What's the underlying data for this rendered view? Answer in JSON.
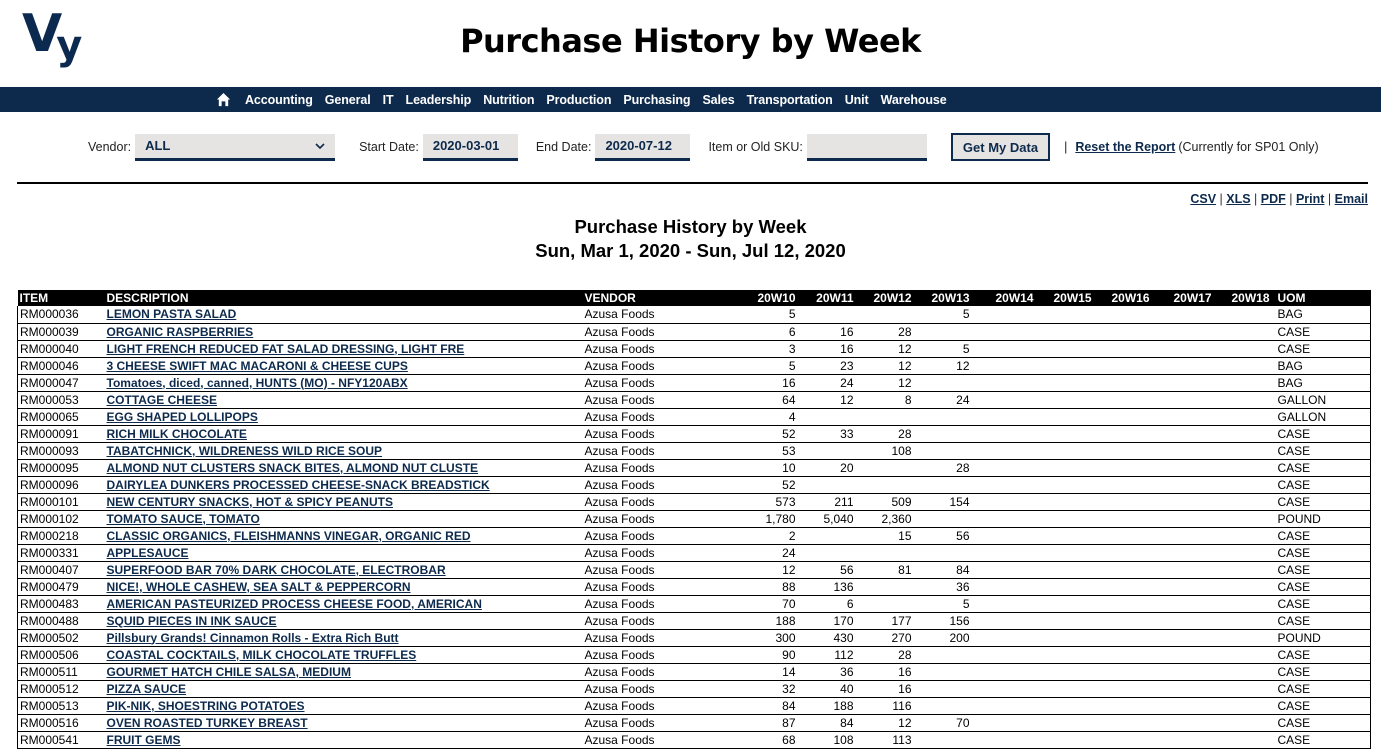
{
  "header": {
    "logo": {
      "v": "V",
      "y": "y"
    },
    "title": "Purchase History by Week"
  },
  "nav": {
    "home_icon": "home-icon",
    "items": [
      "Accounting",
      "General",
      "IT",
      "Leadership",
      "Nutrition",
      "Production",
      "Purchasing",
      "Sales",
      "Transportation",
      "Unit",
      "Warehouse"
    ]
  },
  "filters": {
    "vendor_label": "Vendor:",
    "vendor_value": "ALL",
    "start_label": "Start Date:",
    "start_value": "2020-03-01",
    "end_label": "End Date:",
    "end_value": "2020-07-12",
    "sku_label": "Item or Old SKU:",
    "sku_value": "",
    "get_data_label": "Get My Data",
    "separator": "|",
    "reset_label": "Reset the Report",
    "reset_note": "(Currently for SP01 Only)"
  },
  "exports": {
    "links": [
      "CSV",
      "XLS",
      "PDF",
      "Print",
      "Email"
    ],
    "separator": " | "
  },
  "report": {
    "title": "Purchase History by Week",
    "date_range": "Sun, Mar 1, 2020 - Sun, Jul 12, 2020"
  },
  "table": {
    "columns": [
      "ITEM",
      "DESCRIPTION",
      "VENDOR",
      "20W10",
      "20W11",
      "20W12",
      "20W13",
      "20W14",
      "20W15",
      "20W16",
      "20W17",
      "20W18",
      "UOM"
    ],
    "rows": [
      {
        "item": "RM000036",
        "description": "LEMON PASTA SALAD",
        "vendor": "Azusa Foods",
        "weeks": [
          "5",
          "",
          "",
          "5",
          "",
          "",
          "",
          "",
          ""
        ],
        "uom": "BAG"
      },
      {
        "item": "RM000039",
        "description": "ORGANIC RASPBERRIES",
        "vendor": "Azusa Foods",
        "weeks": [
          "6",
          "16",
          "28",
          "",
          "",
          "",
          "",
          "",
          ""
        ],
        "uom": "CASE"
      },
      {
        "item": "RM000040",
        "description": "LIGHT FRENCH REDUCED FAT SALAD DRESSING, LIGHT FRE",
        "vendor": "Azusa Foods",
        "weeks": [
          "3",
          "16",
          "12",
          "5",
          "",
          "",
          "",
          "",
          ""
        ],
        "uom": "CASE"
      },
      {
        "item": "RM000046",
        "description": "3 CHEESE SWIFT MAC MACARONI & CHEESE CUPS",
        "vendor": "Azusa Foods",
        "weeks": [
          "5",
          "23",
          "12",
          "12",
          "",
          "",
          "",
          "",
          ""
        ],
        "uom": "BAG"
      },
      {
        "item": "RM000047",
        "description": "Tomatoes, diced, canned, HUNTS (MO) - NFY120ABX",
        "vendor": "Azusa Foods",
        "weeks": [
          "16",
          "24",
          "12",
          "",
          "",
          "",
          "",
          "",
          ""
        ],
        "uom": "BAG"
      },
      {
        "item": "RM000053",
        "description": "COTTAGE CHEESE",
        "vendor": "Azusa Foods",
        "weeks": [
          "64",
          "12",
          "8",
          "24",
          "",
          "",
          "",
          "",
          ""
        ],
        "uom": "GALLON"
      },
      {
        "item": "RM000065",
        "description": "EGG SHAPED LOLLIPOPS",
        "vendor": "Azusa Foods",
        "weeks": [
          "4",
          "",
          "",
          "",
          "",
          "",
          "",
          "",
          ""
        ],
        "uom": "GALLON"
      },
      {
        "item": "RM000091",
        "description": "RICH MILK CHOCOLATE",
        "vendor": "Azusa Foods",
        "weeks": [
          "52",
          "33",
          "28",
          "",
          "",
          "",
          "",
          "",
          ""
        ],
        "uom": "CASE"
      },
      {
        "item": "RM000093",
        "description": "TABATCHNICK, WILDRENESS WILD RICE SOUP",
        "vendor": "Azusa Foods",
        "weeks": [
          "53",
          "",
          "108",
          "",
          "",
          "",
          "",
          "",
          ""
        ],
        "uom": "CASE"
      },
      {
        "item": "RM000095",
        "description": "ALMOND NUT CLUSTERS SNACK BITES, ALMOND NUT CLUSTE",
        "vendor": "Azusa Foods",
        "weeks": [
          "10",
          "20",
          "",
          "28",
          "",
          "",
          "",
          "",
          ""
        ],
        "uom": "CASE"
      },
      {
        "item": "RM000096",
        "description": "DAIRYLEA DUNKERS PROCESSED CHEESE-SNACK BREADSTICK",
        "vendor": "Azusa Foods",
        "weeks": [
          "52",
          "",
          "",
          "",
          "",
          "",
          "",
          "",
          ""
        ],
        "uom": "CASE"
      },
      {
        "item": "RM000101",
        "description": "NEW CENTURY SNACKS, HOT & SPICY PEANUTS",
        "vendor": "Azusa Foods",
        "weeks": [
          "573",
          "211",
          "509",
          "154",
          "",
          "",
          "",
          "",
          ""
        ],
        "uom": "CASE"
      },
      {
        "item": "RM000102",
        "description": "TOMATO SAUCE, TOMATO",
        "vendor": "Azusa Foods",
        "weeks": [
          "1,780",
          "5,040",
          "2,360",
          "",
          "",
          "",
          "",
          "",
          ""
        ],
        "uom": "POUND"
      },
      {
        "item": "RM000218",
        "description": "CLASSIC ORGANICS, FLEISHMANNS VINEGAR, ORGANIC RED",
        "vendor": "Azusa Foods",
        "weeks": [
          "2",
          "",
          "15",
          "56",
          "",
          "",
          "",
          "",
          ""
        ],
        "uom": "CASE"
      },
      {
        "item": "RM000331",
        "description": "APPLESAUCE",
        "vendor": "Azusa Foods",
        "weeks": [
          "24",
          "",
          "",
          "",
          "",
          "",
          "",
          "",
          ""
        ],
        "uom": "CASE"
      },
      {
        "item": "RM000407",
        "description": "SUPERFOOD BAR 70% DARK CHOCOLATE, ELECTROBAR",
        "vendor": "Azusa Foods",
        "weeks": [
          "12",
          "56",
          "81",
          "84",
          "",
          "",
          "",
          "",
          ""
        ],
        "uom": "CASE"
      },
      {
        "item": "RM000479",
        "description": "NICE!, WHOLE CASHEW, SEA SALT & PEPPERCORN",
        "vendor": "Azusa Foods",
        "weeks": [
          "88",
          "136",
          "",
          "36",
          "",
          "",
          "",
          "",
          ""
        ],
        "uom": "CASE"
      },
      {
        "item": "RM000483",
        "description": "AMERICAN PASTEURIZED PROCESS CHEESE FOOD, AMERICAN",
        "vendor": "Azusa Foods",
        "weeks": [
          "70",
          "6",
          "",
          "5",
          "",
          "",
          "",
          "",
          ""
        ],
        "uom": "CASE"
      },
      {
        "item": "RM000488",
        "description": "SQUID PIECES IN INK SAUCE",
        "vendor": "Azusa Foods",
        "weeks": [
          "188",
          "170",
          "177",
          "156",
          "",
          "",
          "",
          "",
          ""
        ],
        "uom": "CASE"
      },
      {
        "item": "RM000502",
        "description": "Pillsbury Grands! Cinnamon Rolls - Extra Rich Butt",
        "vendor": "Azusa Foods",
        "weeks": [
          "300",
          "430",
          "270",
          "200",
          "",
          "",
          "",
          "",
          ""
        ],
        "uom": "POUND"
      },
      {
        "item": "RM000506",
        "description": "COASTAL COCKTAILS, MILK CHOCOLATE TRUFFLES",
        "vendor": "Azusa Foods",
        "weeks": [
          "90",
          "112",
          "28",
          "",
          "",
          "",
          "",
          "",
          ""
        ],
        "uom": "CASE"
      },
      {
        "item": "RM000511",
        "description": "GOURMET HATCH CHILE SALSA, MEDIUM",
        "vendor": "Azusa Foods",
        "weeks": [
          "14",
          "36",
          "16",
          "",
          "",
          "",
          "",
          "",
          ""
        ],
        "uom": "CASE"
      },
      {
        "item": "RM000512",
        "description": "PIZZA SAUCE",
        "vendor": "Azusa Foods",
        "weeks": [
          "32",
          "40",
          "16",
          "",
          "",
          "",
          "",
          "",
          ""
        ],
        "uom": "CASE"
      },
      {
        "item": "RM000513",
        "description": "PIK-NIK, SHOESTRING POTATOES",
        "vendor": "Azusa Foods",
        "weeks": [
          "84",
          "188",
          "116",
          "",
          "",
          "",
          "",
          "",
          ""
        ],
        "uom": "CASE"
      },
      {
        "item": "RM000516",
        "description": "OVEN ROASTED TURKEY BREAST",
        "vendor": "Azusa Foods",
        "weeks": [
          "87",
          "84",
          "12",
          "70",
          "",
          "",
          "",
          "",
          ""
        ],
        "uom": "CASE"
      },
      {
        "item": "RM000541",
        "description": "FRUIT GEMS",
        "vendor": "Azusa Foods",
        "weeks": [
          "68",
          "108",
          "113",
          "",
          "",
          "",
          "",
          "",
          ""
        ],
        "uom": "CASE"
      }
    ]
  }
}
